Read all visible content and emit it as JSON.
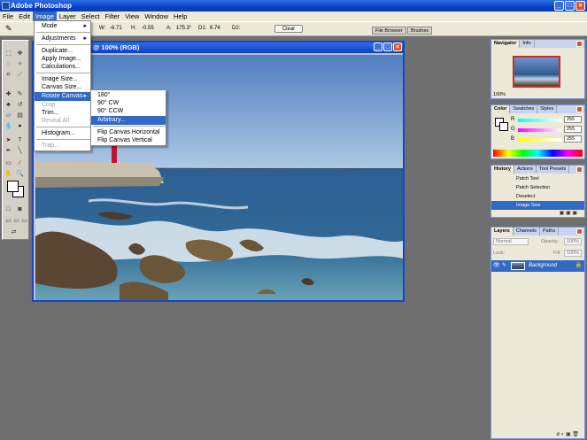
{
  "app": {
    "title": "Adobe Photoshop"
  },
  "menubar": [
    "File",
    "Edit",
    "Image",
    "Layer",
    "Select",
    "Filter",
    "View",
    "Window",
    "Help"
  ],
  "options": {
    "w_label": "W:",
    "w_value": "-6.71",
    "h_label": "H:",
    "h_value": "-0.55",
    "a_label": "A:",
    "a_value": "175.3°",
    "d1_label": "D1:",
    "d1_value": "6.74",
    "d2_label": "D2:",
    "clear_label": "Clear",
    "file_browser_tab": "File Browser",
    "brushes_tab": "Brushes"
  },
  "document": {
    "title": "@ 100% (RGB)"
  },
  "image_menu": {
    "items": [
      {
        "label": "Mode",
        "sub": true,
        "disabled": false
      },
      {
        "label": "Adjustments",
        "sub": true,
        "disabled": false
      },
      {
        "label": "Duplicate...",
        "sub": false,
        "disabled": false
      },
      {
        "label": "Apply Image...",
        "sub": false,
        "disabled": false
      },
      {
        "label": "Calculations...",
        "sub": false,
        "disabled": false
      },
      {
        "label": "Image Size...",
        "sub": false,
        "disabled": false
      },
      {
        "label": "Canvas Size...",
        "sub": false,
        "disabled": false
      },
      {
        "label": "Rotate Canvas",
        "sub": true,
        "disabled": false
      },
      {
        "label": "Crop",
        "sub": false,
        "disabled": true
      },
      {
        "label": "Trim...",
        "sub": false,
        "disabled": false
      },
      {
        "label": "Reveal All",
        "sub": false,
        "disabled": true
      },
      {
        "label": "Histogram...",
        "sub": false,
        "disabled": false
      },
      {
        "label": "Trap...",
        "sub": false,
        "disabled": true
      }
    ]
  },
  "rotate_submenu": {
    "items": [
      "180°",
      "90° CW",
      "90° CCW",
      "Arbitrary...",
      "Flip Canvas Horizontal",
      "Flip Canvas Vertical"
    ]
  },
  "navigator": {
    "tabs": [
      "Navigator",
      "Info"
    ],
    "zoom": "100%"
  },
  "color": {
    "tabs": [
      "Color",
      "Swatches",
      "Styles"
    ],
    "r_label": "R",
    "r_value": "255",
    "g_label": "G",
    "g_value": "255",
    "b_label": "B",
    "b_value": "255"
  },
  "history": {
    "tabs": [
      "History",
      "Actions",
      "Tool Presets"
    ],
    "items": [
      "Patch Tool",
      "Patch Selection",
      "Deselect",
      "Image Size"
    ]
  },
  "layers": {
    "tabs": [
      "Layers",
      "Channels",
      "Paths"
    ],
    "blend_mode": "Normal",
    "opacity_label": "Opacity:",
    "opacity_value": "100%",
    "lock_label": "Lock:",
    "fill_label": "Fill:",
    "fill_value": "100%",
    "layer_name": "Background"
  }
}
